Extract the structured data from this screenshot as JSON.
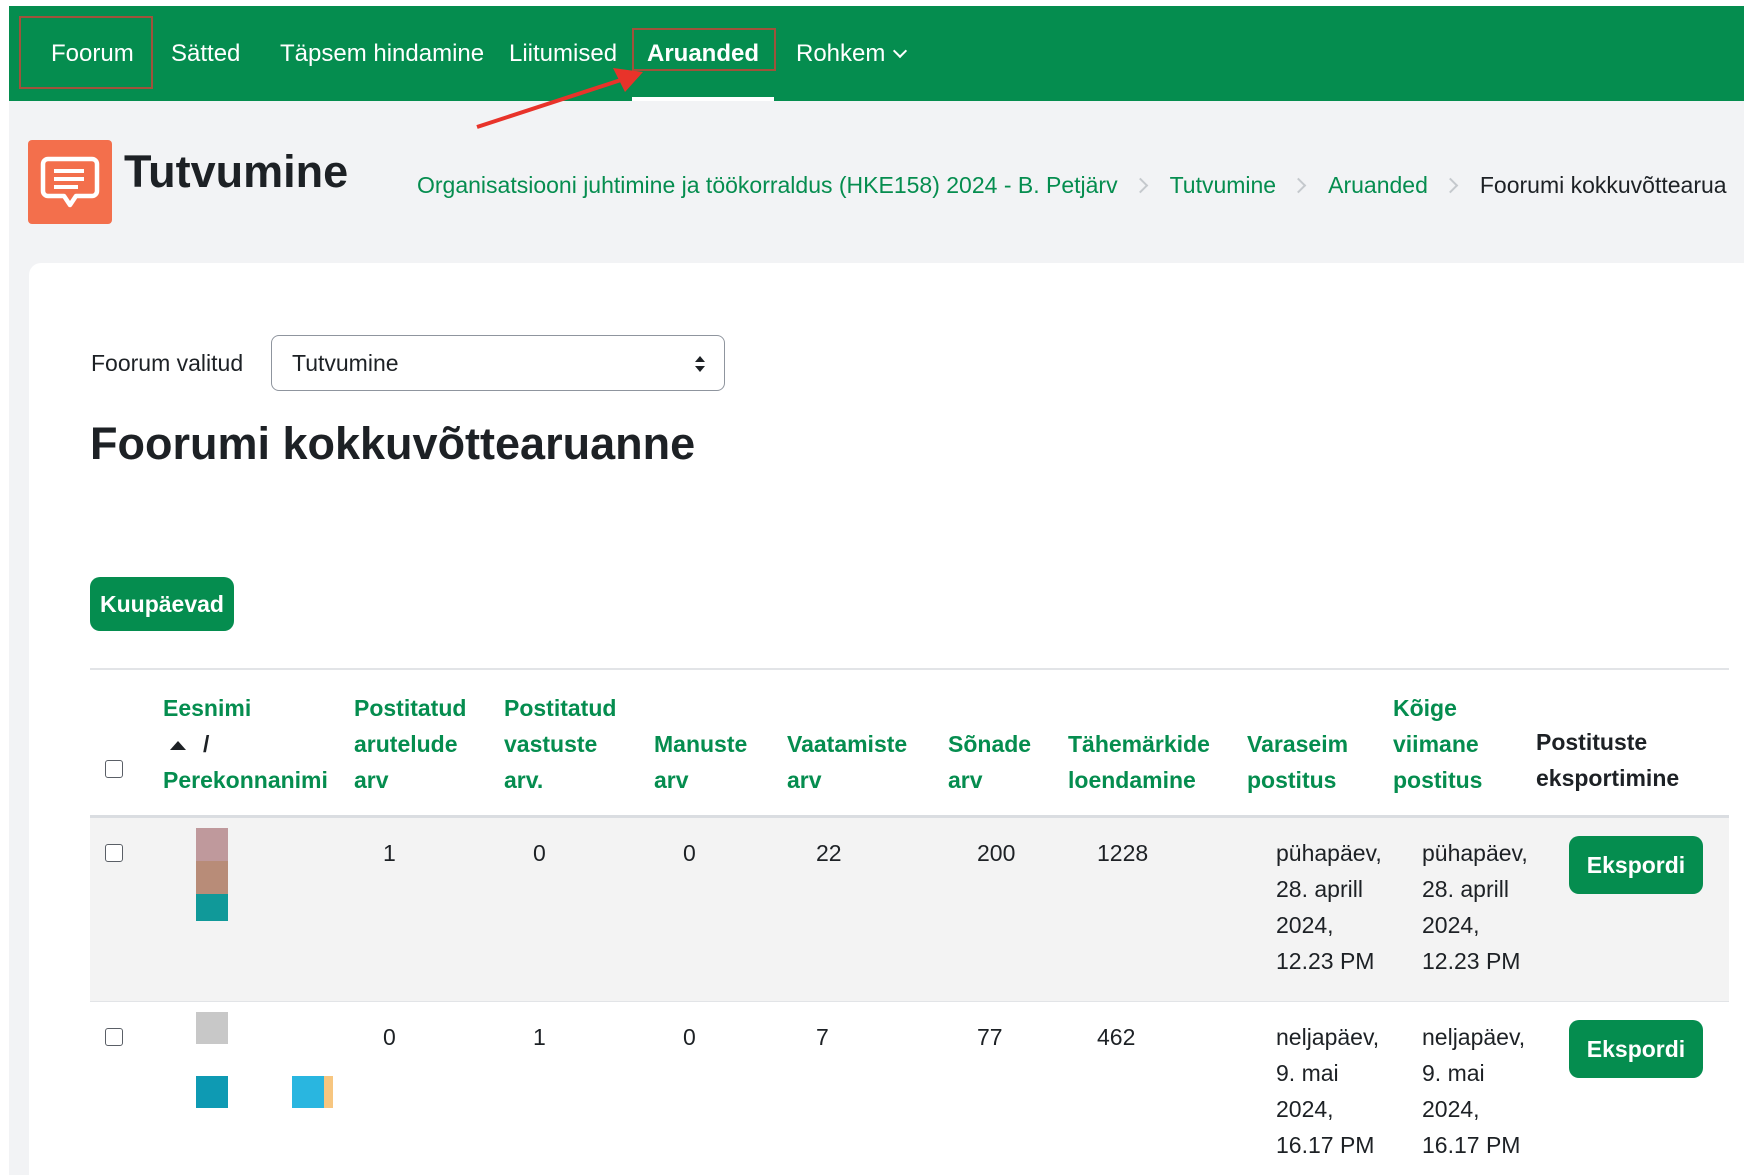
{
  "nav": {
    "tabs": [
      {
        "label": "Foorum"
      },
      {
        "label": "Sätted"
      },
      {
        "label": "Täpsem hindamine"
      },
      {
        "label": "Liitumised"
      },
      {
        "label": "Aruanded"
      },
      {
        "label": "Rohkem"
      }
    ],
    "selected": "Aruanded"
  },
  "header": {
    "title": "Tutvumine",
    "icon": "forum-chat-icon",
    "breadcrumbs": [
      "Organisatsiooni juhtimine ja töökorraldus (HKE158) 2024 - B. Petjärv",
      "Tutvumine",
      "Aruanded",
      "Foorumi kokkuvõttearua"
    ]
  },
  "filter": {
    "label": "Foorum valitud",
    "selected": "Tutvumine"
  },
  "report": {
    "title": "Foorumi kokkuvõttearuanne",
    "dates_button": "Kuupäevad",
    "columns": {
      "firstname": "Eesnimi",
      "slash": "/",
      "lastname": "Perekonnanimi",
      "discussions": [
        "Postitatud",
        "arutelude",
        "arv"
      ],
      "replies": [
        "Postitatud",
        "vastuste",
        "arv."
      ],
      "attachments": [
        "Manuste",
        "arv"
      ],
      "views": [
        "Vaatamiste",
        "arv"
      ],
      "words": [
        "Sõnade",
        "arv"
      ],
      "chars": [
        "Tähemärkide",
        "loendamine"
      ],
      "earliest": [
        "Varaseim",
        "postitus"
      ],
      "latest": [
        "Kõige",
        "viimane",
        "postitus"
      ],
      "export": [
        "Postituste",
        "eksportimine"
      ]
    },
    "rows": [
      {
        "discussions": "1",
        "replies": "0",
        "attachments": "0",
        "views": "22",
        "words": "200",
        "chars": "1228",
        "earliest": [
          "pühapäev,",
          "28. aprill",
          "2024,",
          "12.23 PM"
        ],
        "latest": [
          "pühapäev,",
          "28. aprill",
          "2024,",
          "12.23 PM"
        ],
        "export_label": "Ekspordi"
      },
      {
        "discussions": "0",
        "replies": "1",
        "attachments": "0",
        "views": "7",
        "words": "77",
        "chars": "462",
        "earliest": [
          "neljapäev,",
          "9. mai",
          "2024,",
          "16.17 PM"
        ],
        "latest": [
          "neljapäev,",
          "9. mai",
          "2024,",
          "16.17 PM"
        ],
        "export_label": "Ekspordi"
      }
    ]
  },
  "colors": {
    "brand_green": "#058d4f",
    "forum_icon_bg": "#f36f4c",
    "annotation_red": "#e8332a"
  }
}
